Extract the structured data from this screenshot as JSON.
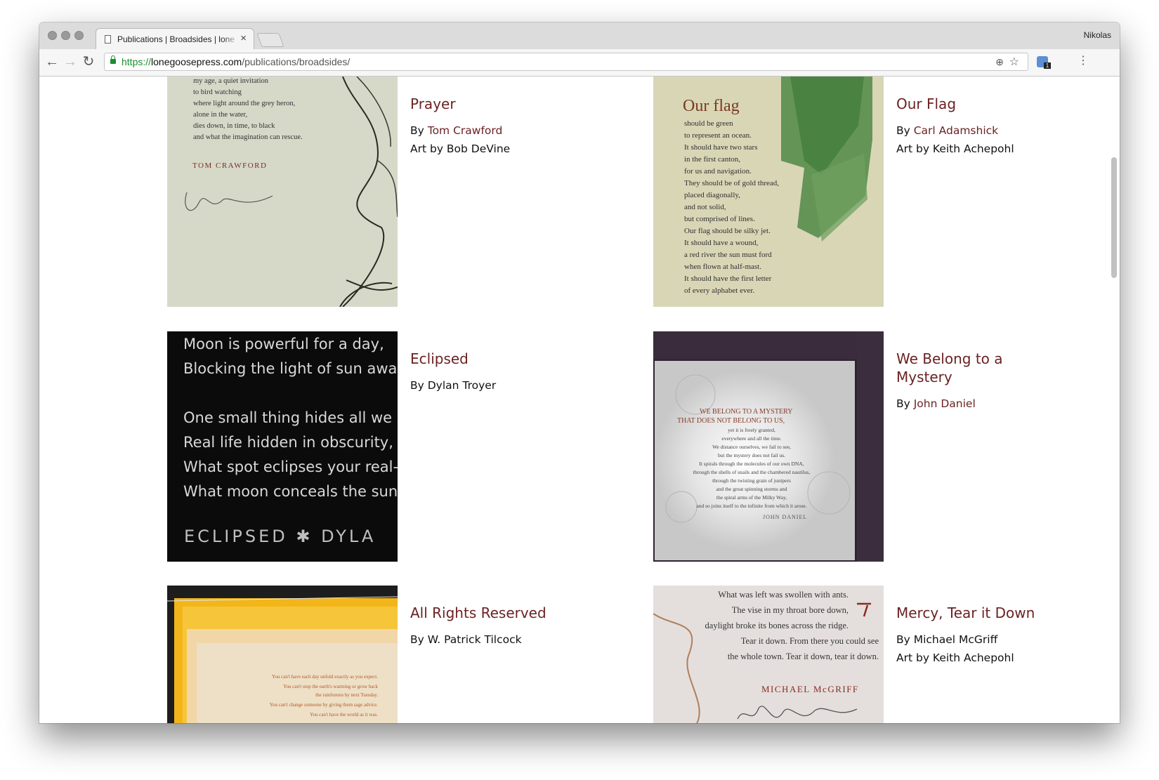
{
  "browser": {
    "tab_title": "Publications | Broadsides | lone",
    "tab_close": "×",
    "profile_name": "Nikolas",
    "nav": {
      "back": "←",
      "forward": "→",
      "reload": "↻"
    },
    "url": {
      "scheme": "https://",
      "host": "lonegoosepress.com",
      "path": "/publications/broadsides/"
    },
    "icons": {
      "lock": "lock-icon",
      "zoom": "magnifier-icon",
      "star": "star-icon",
      "menu": "kebab-menu-icon",
      "extension": "extension-icon"
    },
    "extension_badge": "1",
    "menu_glyph": "⋮",
    "zoom_glyph": "⊕",
    "star_glyph": "☆"
  },
  "broadsides": [
    {
      "title": "Prayer",
      "by_prefix": "By ",
      "author": "Tom Crawford",
      "author_is_link": true,
      "art_prefix": "Art by ",
      "artist": "Bob DeVine",
      "image_text": {
        "lines": [
          "my age, a quiet invitation",
          "to bird watching",
          "where light around the grey heron,",
          "alone in the water,",
          "dies down, in time, to black",
          "and what the imagination can rescue."
        ],
        "signature": "TOM CRAWFORD"
      }
    },
    {
      "title": "Our Flag",
      "by_prefix": "By ",
      "author": "Carl Adamshick",
      "author_is_link": true,
      "art_prefix": "Art by ",
      "artist": "Keith Achepohl",
      "image_text": {
        "heading": "Our flag",
        "lines": [
          "should be green",
          "to represent an ocean.",
          "It should have two stars",
          "in the first canton,",
          "for us and navigation.",
          "They should be of gold thread,",
          "placed diagonally,",
          "and not solid,",
          "but comprised of lines.",
          "Our flag should be silky jet.",
          "It should have a wound,",
          "a red river the sun must ford",
          "when flown at half-mast.",
          "It should have the first letter",
          "of every alphabet ever."
        ]
      }
    },
    {
      "title": "Eclipsed",
      "by_prefix": "By ",
      "author": "Dylan Troyer",
      "author_is_link": false,
      "image_text": {
        "lines": [
          "Moon is powerful for a day,",
          "Blocking the light of sun away",
          "",
          "One small thing hides all we s",
          "Real life hidden in obscurity,",
          "What spot eclipses your real-w",
          "What moon conceals the sun"
        ],
        "footer": "ECLIPSED ✱ DYLA"
      }
    },
    {
      "title": "We Belong to a Mystery",
      "by_prefix": "By ",
      "author": "John Daniel",
      "author_is_link": true,
      "image_text": {
        "heading_lines": [
          "WE BELONG TO A MYSTERY",
          "THAT DOES NOT BELONG TO US,"
        ],
        "lines": [
          "yet it is freely granted,",
          "everywhere and all the time.",
          "We distance ourselves, we fail to see,",
          "but the mystery does not fail us.",
          "It spirals through the molecules of our own DNA,",
          "through the shells of snails and the chambered nautilus,",
          "through the twisting grain of junipers",
          "and the great spinning storms and",
          "the spiral arms of the Milky Way,",
          "and so joins itself to the infinite from which it arose."
        ],
        "signature": "JOHN DANIEL"
      }
    },
    {
      "title": "All Rights Reserved",
      "by_prefix": "By ",
      "author": "W. Patrick Tilcock",
      "author_is_link": false,
      "image_text": {
        "lines": [
          "You can't have each day unfold exactly as you expect.",
          "You can't stop the earth's warming or grow back",
          "the rainforests by next Tuesday.",
          "You can't change someone by giving them sage advice.",
          "You can't have the world as it was."
        ]
      }
    },
    {
      "title": "Mercy, Tear it Down",
      "by_prefix": "By ",
      "author": "Michael McGriff",
      "author_is_link": false,
      "art_prefix": "Art by ",
      "artist": "Keith Achepohl",
      "image_text": {
        "lines": [
          "What was left was swollen with ants.",
          "The vise in my throat bore down,",
          "daylight broke its bones across the ridge.",
          "Tear it down. From there you could see",
          "the whole town. Tear it down, tear it down."
        ],
        "signature": "MICHAEL McGRIFF"
      }
    }
  ]
}
